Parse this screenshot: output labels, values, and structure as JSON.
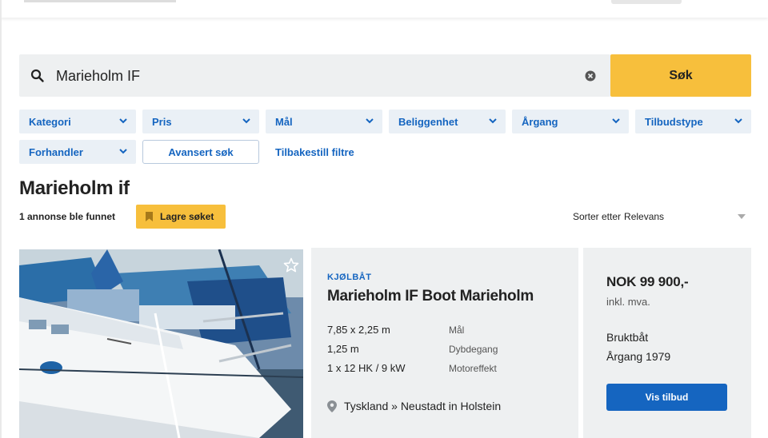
{
  "search": {
    "query": "Marieholm IF",
    "button_label": "Søk"
  },
  "filters": [
    {
      "label": "Kategori"
    },
    {
      "label": "Pris"
    },
    {
      "label": "Mål"
    },
    {
      "label": "Beliggenhet"
    },
    {
      "label": "Årgang"
    },
    {
      "label": "Tilbudstype"
    },
    {
      "label": "Forhandler"
    }
  ],
  "advanced_search_label": "Avansert søk",
  "reset_filters_label": "Tilbakestill filtre",
  "results": {
    "title": "Marieholm if",
    "count_text": "1 annonse ble funnet",
    "save_search_label": "Lagre søket",
    "sort_label": "Sorter etter",
    "sort_value": "Relevans"
  },
  "listing": {
    "category": "KJØLBÅT",
    "title": "Marieholm IF Boot Marieholm",
    "specs": [
      {
        "value": "7,85 x 2,25 m",
        "label": "Mål"
      },
      {
        "value": "1,25 m",
        "label": "Dybdegang"
      },
      {
        "value": "1 x 12 HK / 9 kW",
        "label": "Motoreffekt"
      }
    ],
    "location": "Tyskland » Neustadt in Holstein",
    "price": "NOK 99 900,-",
    "vat_note": "inkl. mva.",
    "condition": "Bruktbåt",
    "year": "Årgang 1979",
    "view_button_label": "Vis tilbud"
  },
  "colors": {
    "accent_yellow": "#f7bf3c",
    "link_blue": "#1565c0",
    "panel_gray": "#eef0f1"
  },
  "icons": [
    "search-icon",
    "clear-icon",
    "chevron-down-icon",
    "bookmark-icon",
    "star-icon",
    "location-pin-icon"
  ]
}
